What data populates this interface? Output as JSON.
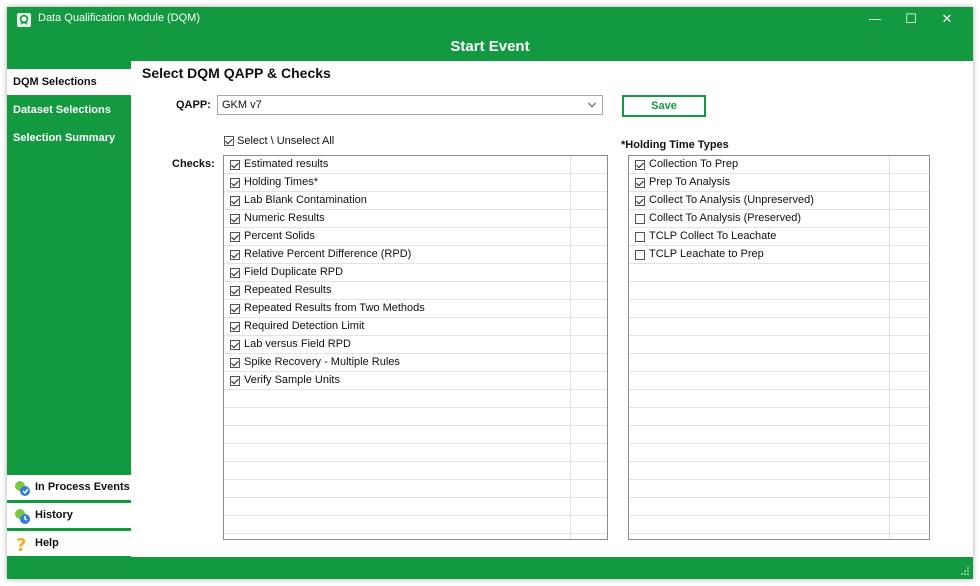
{
  "window": {
    "title": "Data Qualification Module (DQM)",
    "header_title": "Start Event",
    "accent_color": "#139a40",
    "controls": {
      "minimize": "—",
      "maximize": "☐",
      "close": "✕"
    }
  },
  "sidebar": {
    "items": [
      {
        "label": "DQM Selections",
        "active": true
      },
      {
        "label": "Dataset Selections",
        "active": false
      },
      {
        "label": "Selection Summary",
        "active": false
      }
    ],
    "bottom_items": [
      {
        "label": "In Process Events",
        "icon": "events-icon"
      },
      {
        "label": "History",
        "icon": "history-icon"
      },
      {
        "label": "Help",
        "icon": "help-icon"
      }
    ]
  },
  "main": {
    "title": "Select DQM QAPP & Checks",
    "qapp_label": "QAPP:",
    "qapp_value": "GKM v7",
    "save_label": "Save",
    "select_all_label": "Select \\ Unselect All",
    "checks_label": "Checks:",
    "holding_title": "*Holding Time Types",
    "checks": [
      {
        "label": "Estimated results",
        "checked": true
      },
      {
        "label": "Holding Times*",
        "checked": true
      },
      {
        "label": "Lab Blank Contamination",
        "checked": true
      },
      {
        "label": "Numeric Results",
        "checked": true
      },
      {
        "label": "Percent Solids",
        "checked": true
      },
      {
        "label": "Relative Percent Difference (RPD)",
        "checked": true
      },
      {
        "label": "Field Duplicate RPD",
        "checked": true
      },
      {
        "label": "Repeated Results",
        "checked": true
      },
      {
        "label": "Repeated Results from Two Methods",
        "checked": true
      },
      {
        "label": "Required Detection Limit",
        "checked": true
      },
      {
        "label": "Lab versus Field RPD",
        "checked": true
      },
      {
        "label": "Spike Recovery - Multiple Rules",
        "checked": true
      },
      {
        "label": "Verify Sample Units",
        "checked": true
      }
    ],
    "holding_types": [
      {
        "label": "Collection To Prep",
        "checked": true
      },
      {
        "label": "Prep To Analysis",
        "checked": true
      },
      {
        "label": "Collect To Analysis (Unpreserved)",
        "checked": true
      },
      {
        "label": "Collect To Analysis (Preserved)",
        "checked": false
      },
      {
        "label": "TCLP Collect To Leachate",
        "checked": false
      },
      {
        "label": "TCLP Leachate to Prep",
        "checked": false
      }
    ]
  }
}
